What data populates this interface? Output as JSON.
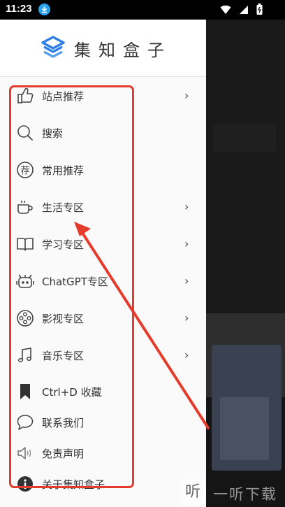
{
  "status_bar": {
    "time": "11:23",
    "icons": [
      "download-icon",
      "wifi-icon",
      "signal-icon",
      "battery-icon"
    ]
  },
  "app": {
    "name": "集知盒子",
    "logo_icon": "stacked-layers-logo-icon"
  },
  "menu": {
    "items": [
      {
        "label": "站点推荐",
        "icon": "thumbs-up-icon",
        "has_submenu": true
      },
      {
        "label": "搜索",
        "icon": "search-icon",
        "has_submenu": false
      },
      {
        "label": "常用推荐",
        "icon": "recommend-badge-icon",
        "has_submenu": false
      },
      {
        "label": "生活专区",
        "icon": "coffee-cup-icon",
        "has_submenu": true
      },
      {
        "label": "学习专区",
        "icon": "book-icon",
        "has_submenu": true
      },
      {
        "label": "ChatGPT专区",
        "icon": "robot-icon",
        "has_submenu": true
      },
      {
        "label": "影视专区",
        "icon": "film-reel-icon",
        "has_submenu": true
      },
      {
        "label": "音乐专区",
        "icon": "music-note-icon",
        "has_submenu": true
      },
      {
        "label": "Ctrl+D 收藏",
        "icon": "bookmark-icon",
        "has_submenu": false
      },
      {
        "label": "联系我们",
        "icon": "chat-bubble-icon",
        "has_submenu": false
      },
      {
        "label": "免责声明",
        "icon": "speaker-icon",
        "has_submenu": false
      },
      {
        "label": "关于集知盒子",
        "icon": "info-icon",
        "has_submenu": false
      }
    ],
    "chevron": "›"
  },
  "annotation": {
    "color": "#e53b2c"
  },
  "watermark": {
    "logo": "听",
    "text": "一听下载"
  },
  "colors": {
    "drawer_bg": "#fafafa",
    "logo_blue": "#2f7fe6",
    "text": "#333333"
  }
}
